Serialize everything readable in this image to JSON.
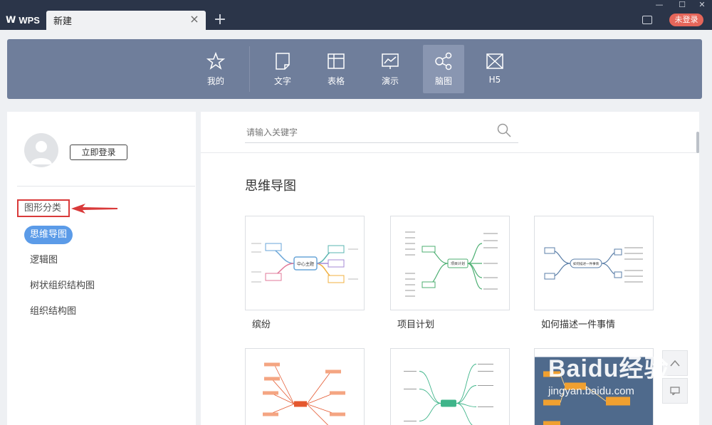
{
  "app": {
    "logo_text": "WPS",
    "tab_title": "新建",
    "tab_close": "×",
    "new_tab": "+",
    "login_badge": "未登录"
  },
  "categories": [
    {
      "label": "我的",
      "icon": "star-icon"
    },
    {
      "label": "文字",
      "icon": "document-icon"
    },
    {
      "label": "表格",
      "icon": "table-icon"
    },
    {
      "label": "演示",
      "icon": "presentation-icon"
    },
    {
      "label": "脑图",
      "icon": "mindmap-icon",
      "active": true
    },
    {
      "label": "H5",
      "icon": "h5-icon"
    }
  ],
  "sidebar": {
    "login_button": "立即登录",
    "section_title": "图形分类",
    "items": [
      {
        "label": "思维导图",
        "active": true
      },
      {
        "label": "逻辑图"
      },
      {
        "label": "树状组织结构图"
      },
      {
        "label": "组织结构图"
      }
    ]
  },
  "search": {
    "placeholder": "请输入关键字"
  },
  "main": {
    "section_title": "思维导图",
    "templates": [
      {
        "label": "缤纷",
        "center_text": "中心主题"
      },
      {
        "label": "项目计划",
        "center_text": "项目计划"
      },
      {
        "label": "如何描述一件事情",
        "center_text": "如何描述一件事情"
      },
      {
        "label": ""
      },
      {
        "label": ""
      },
      {
        "label": ""
      }
    ]
  },
  "watermark": {
    "brand": "Baidu经验",
    "url": "jingyan.baidu.com"
  },
  "colors": {
    "titlebar": "#2b3549",
    "catbar": "#6f7e9b",
    "active_item": "#5b9be8",
    "login_badge": "#e5665a",
    "highlight_box": "#d93a3a"
  }
}
